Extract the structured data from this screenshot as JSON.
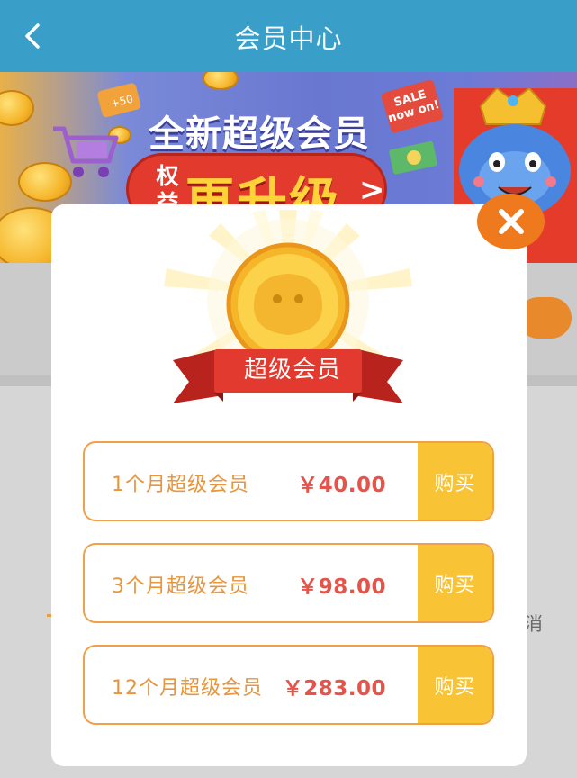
{
  "header": {
    "title": "会员中心",
    "back_icon": "chevron-left-icon"
  },
  "banner": {
    "headline": "全新超级会员",
    "pill_small": "权益",
    "pill_big": "再升级",
    "pill_arrow": ">",
    "sale_tag": "SALE\nnow on!"
  },
  "background": {
    "partial_text": "消"
  },
  "modal": {
    "close_icon": "close-icon",
    "badge_label": "超级会员",
    "plans": [
      {
        "name": "1个月超级会员",
        "price": "￥40.00",
        "buy_label": "购买"
      },
      {
        "name": "3个月超级会员",
        "price": "￥98.00",
        "buy_label": "购买"
      },
      {
        "name": "12个月超级会员",
        "price": "￥283.00",
        "buy_label": "购买"
      }
    ]
  },
  "colors": {
    "header_bg": "#3a9fc8",
    "plan_border": "#f1a04a",
    "plan_text": "#e8953c",
    "price_text": "#e4544a",
    "buy_bg": "#f8c334",
    "close_bg": "#ef7a1d",
    "ribbon": "#d9302a"
  }
}
